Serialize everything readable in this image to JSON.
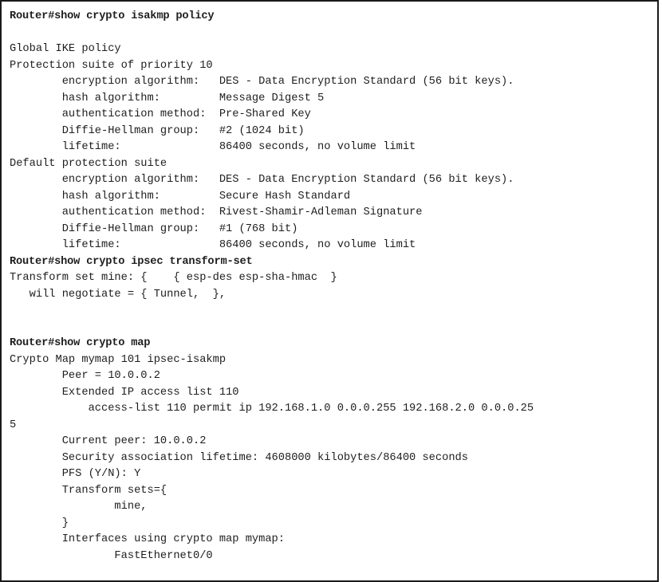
{
  "terminal": {
    "lines": [
      "Router#show crypto isakmp policy",
      "",
      "Global IKE policy",
      "Protection suite of priority 10",
      "        encryption algorithm:   DES - Data Encryption Standard (56 bit keys).",
      "        hash algorithm:         Message Digest 5",
      "        authentication method:  Pre-Shared Key",
      "        Diffie-Hellman group:   #2 (1024 bit)",
      "        lifetime:               86400 seconds, no volume limit",
      "Default protection suite",
      "        encryption algorithm:   DES - Data Encryption Standard (56 bit keys).",
      "        hash algorithm:         Secure Hash Standard",
      "        authentication method:  Rivest-Shamir-Adleman Signature",
      "        Diffie-Hellman group:   #1 (768 bit)",
      "        lifetime:               86400 seconds, no volume limit",
      "Router#show crypto ipsec transform-set",
      "Transform set mine: {    { esp-des esp-sha-hmac  }",
      "   will negotiate = { Tunnel,  },",
      "",
      "",
      "Router#show crypto map",
      "Crypto Map mymap 101 ipsec-isakmp",
      "        Peer = 10.0.0.2",
      "        Extended IP access list 110",
      "            access-list 110 permit ip 192.168.1.0 0.0.0.255 192.168.2.0 0.0.0.25",
      "5",
      "        Current peer: 10.0.0.2",
      "        Security association lifetime: 4608000 kilobytes/86400 seconds",
      "        PFS (Y/N): Y",
      "        Transform sets={",
      "                mine,",
      "        }",
      "        Interfaces using crypto map mymap:",
      "                FastEthernet0/0"
    ]
  }
}
